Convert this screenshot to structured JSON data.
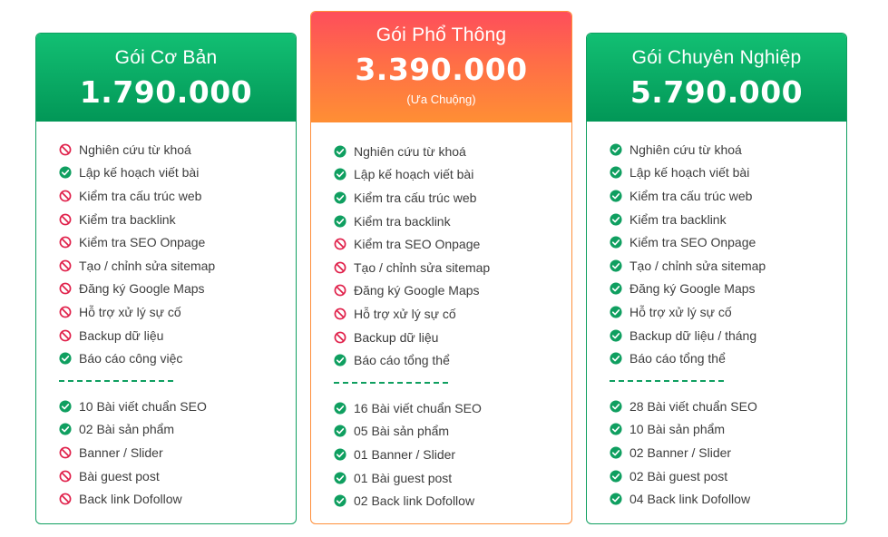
{
  "colors": {
    "green": "#0f9f60",
    "red": "#e0204a",
    "orange": "#ff8f34"
  },
  "plans": [
    {
      "name": "Gói Cơ Bản",
      "price": "1.790.000",
      "note": "",
      "theme": "green",
      "features": [
        {
          "label": "Nghiên cứu từ khoá",
          "included": false
        },
        {
          "label": "Lập kế hoạch viết bài",
          "included": true
        },
        {
          "label": "Kiểm tra cấu trúc web",
          "included": false
        },
        {
          "label": "Kiểm tra backlink",
          "included": false
        },
        {
          "label": "Kiểm tra SEO Onpage",
          "included": false
        },
        {
          "label": "Tạo / chỉnh sửa sitemap",
          "included": false
        },
        {
          "label": "Đăng ký Google Maps",
          "included": false
        },
        {
          "label": "Hỗ trợ xử lý sự cố",
          "included": false
        },
        {
          "label": "Backup dữ liệu",
          "included": false
        },
        {
          "label": "Báo cáo công việc",
          "included": true
        }
      ],
      "deliverables": [
        {
          "label": "10 Bài viết chuẩn SEO",
          "included": true
        },
        {
          "label": "02 Bài sản phẩm",
          "included": true
        },
        {
          "label": "Banner / Slider",
          "included": false
        },
        {
          "label": "Bài guest post",
          "included": false
        },
        {
          "label": "Back link Dofollow",
          "included": false
        }
      ]
    },
    {
      "name": "Gói Phổ Thông",
      "price": "3.390.000",
      "note": "(Ưa Chuộng)",
      "theme": "orange",
      "features": [
        {
          "label": "Nghiên cứu từ khoá",
          "included": true
        },
        {
          "label": "Lập kế hoạch viết bài",
          "included": true
        },
        {
          "label": "Kiểm tra cấu trúc web",
          "included": true
        },
        {
          "label": "Kiểm tra backlink",
          "included": true
        },
        {
          "label": "Kiểm tra SEO Onpage",
          "included": false
        },
        {
          "label": "Tạo / chỉnh sửa sitemap",
          "included": false
        },
        {
          "label": "Đăng ký Google Maps",
          "included": false
        },
        {
          "label": "Hỗ trợ xử lý sự cố",
          "included": false
        },
        {
          "label": "Backup dữ liệu",
          "included": false
        },
        {
          "label": "Báo cáo tổng thể",
          "included": true
        }
      ],
      "deliverables": [
        {
          "label": "16 Bài viết chuẩn SEO",
          "included": true
        },
        {
          "label": "05 Bài sản phẩm",
          "included": true
        },
        {
          "label": "01 Banner / Slider",
          "included": true
        },
        {
          "label": "01 Bài guest post",
          "included": true
        },
        {
          "label": "02 Back link Dofollow",
          "included": true
        }
      ]
    },
    {
      "name": "Gói Chuyên Nghiệp",
      "price": "5.790.000",
      "note": "",
      "theme": "green",
      "features": [
        {
          "label": "Nghiên cứu từ khoá",
          "included": true
        },
        {
          "label": "Lập kế hoạch viết bài",
          "included": true
        },
        {
          "label": "Kiểm tra cấu trúc web",
          "included": true
        },
        {
          "label": "Kiểm tra backlink",
          "included": true
        },
        {
          "label": "Kiểm tra SEO Onpage",
          "included": true
        },
        {
          "label": "Tạo / chỉnh sửa sitemap",
          "included": true
        },
        {
          "label": "Đăng ký Google Maps",
          "included": true
        },
        {
          "label": "Hỗ trợ xử lý sự cố",
          "included": true
        },
        {
          "label": "Backup dữ liệu / tháng",
          "included": true
        },
        {
          "label": "Báo cáo tổng thể",
          "included": true
        }
      ],
      "deliverables": [
        {
          "label": "28 Bài viết chuẩn SEO",
          "included": true
        },
        {
          "label": "10 Bài sản phẩm",
          "included": true
        },
        {
          "label": "02 Banner / Slider",
          "included": true
        },
        {
          "label": "02 Bài guest post",
          "included": true
        },
        {
          "label": "04 Back link Dofollow",
          "included": true
        }
      ]
    }
  ]
}
